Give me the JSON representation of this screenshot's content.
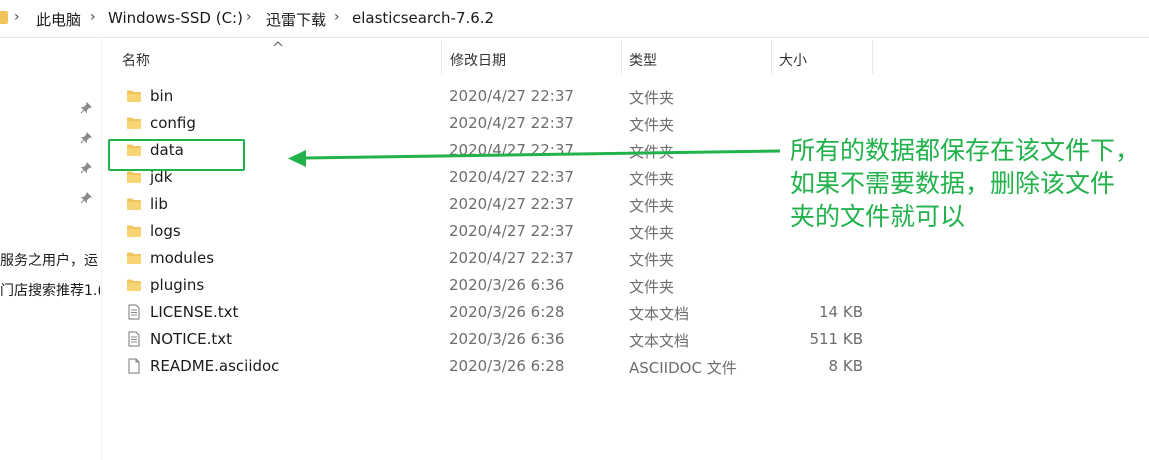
{
  "breadcrumb": {
    "items": [
      "此电脑",
      "Windows-SSD (C:)",
      "迅雷下载",
      "elasticsearch-7.6.2"
    ]
  },
  "left_pane": {
    "cut_text": [
      "服务之用户，运",
      "门店搜索推荐1.("
    ]
  },
  "columns": {
    "name": "名称",
    "date": "修改日期",
    "type": "类型",
    "size": "大小"
  },
  "files": [
    {
      "name": "bin",
      "date": "2020/4/27 22:37",
      "type": "文件夹",
      "size": "",
      "icon": "folder-icon"
    },
    {
      "name": "config",
      "date": "2020/4/27 22:37",
      "type": "文件夹",
      "size": "",
      "icon": "folder-icon"
    },
    {
      "name": "data",
      "date": "2020/4/27 22:37",
      "type": "文件夹",
      "size": "",
      "icon": "folder-icon"
    },
    {
      "name": "jdk",
      "date": "2020/4/27 22:37",
      "type": "文件夹",
      "size": "",
      "icon": "folder-icon"
    },
    {
      "name": "lib",
      "date": "2020/4/27 22:37",
      "type": "文件夹",
      "size": "",
      "icon": "folder-icon"
    },
    {
      "name": "logs",
      "date": "2020/4/27 22:37",
      "type": "文件夹",
      "size": "",
      "icon": "folder-icon"
    },
    {
      "name": "modules",
      "date": "2020/4/27 22:37",
      "type": "文件夹",
      "size": "",
      "icon": "folder-icon"
    },
    {
      "name": "plugins",
      "date": "2020/3/26 6:36",
      "type": "文件夹",
      "size": "",
      "icon": "folder-icon"
    },
    {
      "name": "LICENSE.txt",
      "date": "2020/3/26 6:28",
      "type": "文本文档",
      "size": "14 KB",
      "icon": "text-file-icon"
    },
    {
      "name": "NOTICE.txt",
      "date": "2020/3/26 6:36",
      "type": "文本文档",
      "size": "511 KB",
      "icon": "text-file-icon"
    },
    {
      "name": "README.asciidoc",
      "date": "2020/3/26 6:28",
      "type": "ASCIIDOC 文件",
      "size": "8 KB",
      "icon": "file-icon"
    }
  ],
  "annotation": {
    "lines": [
      "所有的数据都保存在该文件下，",
      "如果不需要数据，删除该文件",
      "夹的文件就可以"
    ],
    "color": "#22b24c"
  },
  "colors": {
    "folder": "#f2c55c",
    "secondary_text": "#6d6d6d"
  }
}
